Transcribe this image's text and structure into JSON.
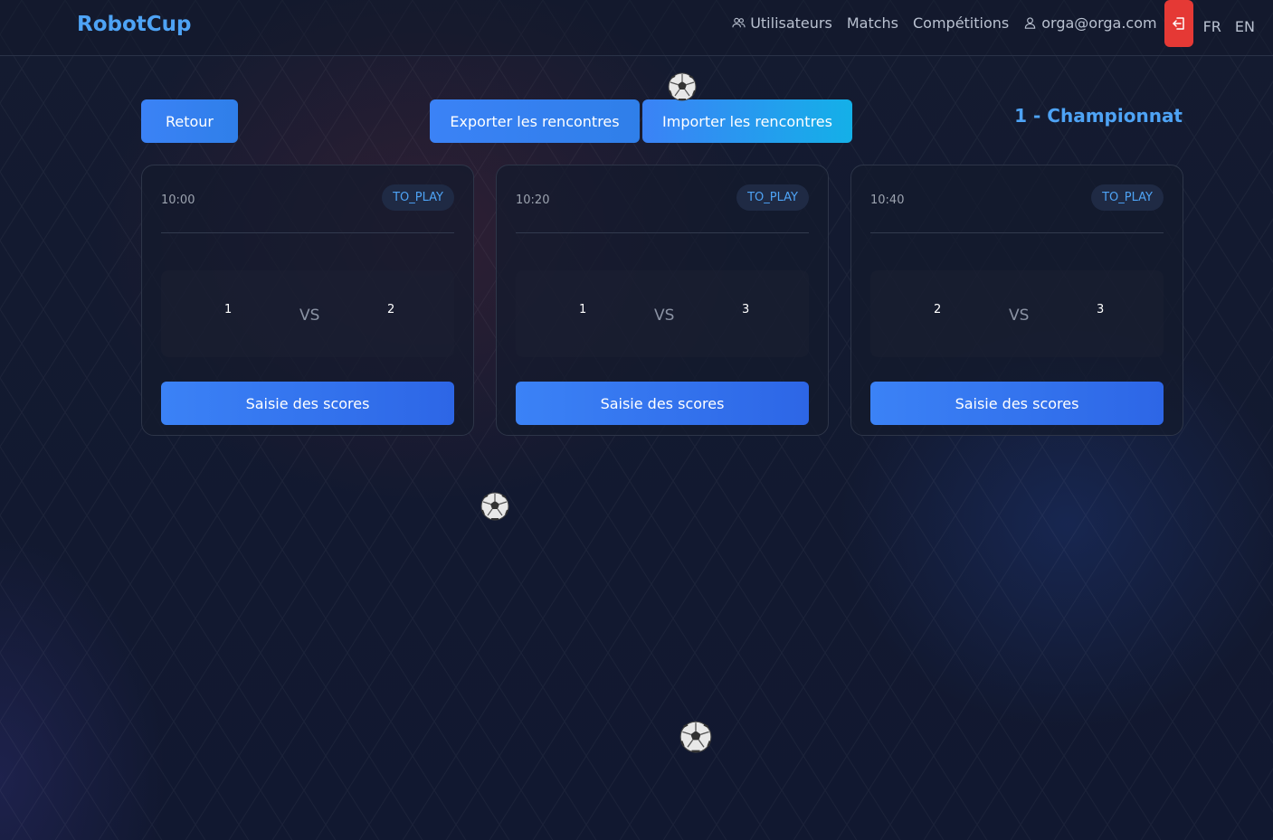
{
  "nav": {
    "brand": "RobotCup",
    "users": "Utilisateurs",
    "matches": "Matchs",
    "competitions": "Compétitions",
    "account": "orga@orga.com",
    "lang_fr": "FR",
    "lang_en": "EN"
  },
  "actions": {
    "back": "Retour",
    "export": "Exporter les rencontres",
    "import": "Importer les rencontres"
  },
  "competition_title": "1 - Championnat",
  "matches": [
    {
      "time": "10:00",
      "status": "TO_PLAY",
      "team_a": "1",
      "team_b": "2",
      "vs": "VS",
      "button": "Saisie des scores"
    },
    {
      "time": "10:20",
      "status": "TO_PLAY",
      "team_a": "1",
      "team_b": "3",
      "vs": "VS",
      "button": "Saisie des scores"
    },
    {
      "time": "10:40",
      "status": "TO_PLAY",
      "team_a": "2",
      "team_b": "3",
      "vs": "VS",
      "button": "Saisie des scores"
    }
  ],
  "colors": {
    "accent": "#4ea3f5",
    "button": "#3b82f6",
    "danger": "#e53935",
    "background": "#121a2e"
  },
  "icons": [
    "users-icon",
    "user-icon",
    "logout-icon",
    "soccer-ball-icon"
  ]
}
